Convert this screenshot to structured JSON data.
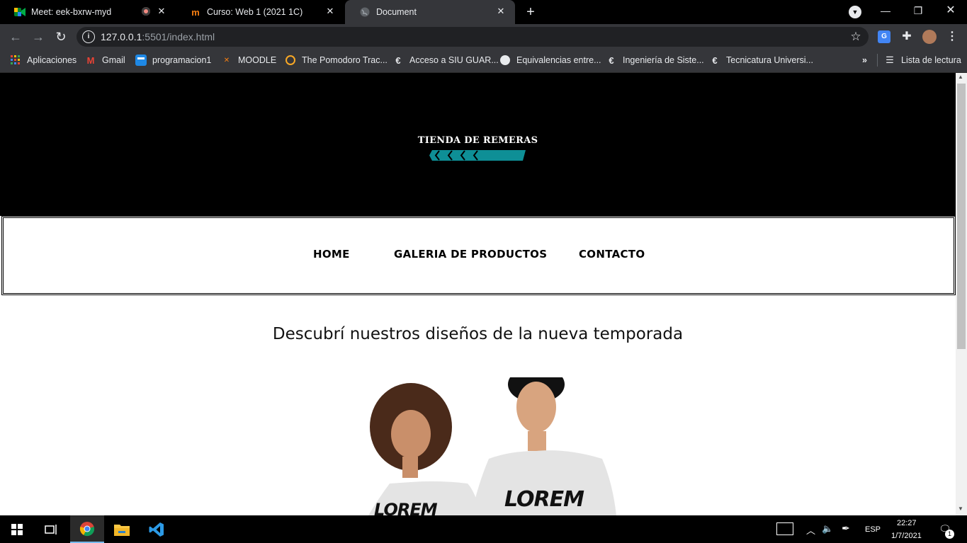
{
  "browser": {
    "tabs": [
      {
        "title": "Meet: eek-bxrw-myd",
        "icon": "google-meet-icon",
        "recording": true
      },
      {
        "title": "Curso: Web 1 (2021 1C)",
        "icon": "moodle-icon"
      },
      {
        "title": "Document",
        "icon": "globe-icon",
        "active": true
      }
    ],
    "url_host": "127.0.0.1",
    "url_rest": ":5501/index.html",
    "bookmarks": [
      {
        "label": "Aplicaciones",
        "icon": "apps-grid-icon"
      },
      {
        "label": "Gmail",
        "icon": "gmail-icon"
      },
      {
        "label": "programacion1",
        "icon": "trello-icon"
      },
      {
        "label": "MOODLE",
        "icon": "moodle-icon"
      },
      {
        "label": "The Pomodoro Trac...",
        "icon": "pomodoro-icon"
      },
      {
        "label": "Acceso a SIU GUAR...",
        "icon": "unicen-e-icon"
      },
      {
        "label": "Equivalencias entre...",
        "icon": "globe-icon"
      },
      {
        "label": "Ingeniería de Siste...",
        "icon": "unicen-e-icon"
      },
      {
        "label": "Tecnicatura Universi...",
        "icon": "unicen-e-icon"
      }
    ],
    "reading_list": "Lista de lectura"
  },
  "site": {
    "logo_text": "TIENDA DE REMERAS",
    "nav": [
      "HOME",
      "GALERIA DE PRODUCTOS",
      "CONTACTO"
    ],
    "headline": "Descubrí nuestros diseños de la nueva temporada",
    "shirt_print_left": "LOREM",
    "shirt_print_right": "LOREM"
  },
  "colors": {
    "accent_teal": "#0e8f96",
    "chrome_dark": "#35363a",
    "tab_strip": "#000000"
  },
  "taskbar": {
    "lang": "ESP",
    "time": "22:27",
    "date": "1/7/2021",
    "notifications": "1"
  }
}
